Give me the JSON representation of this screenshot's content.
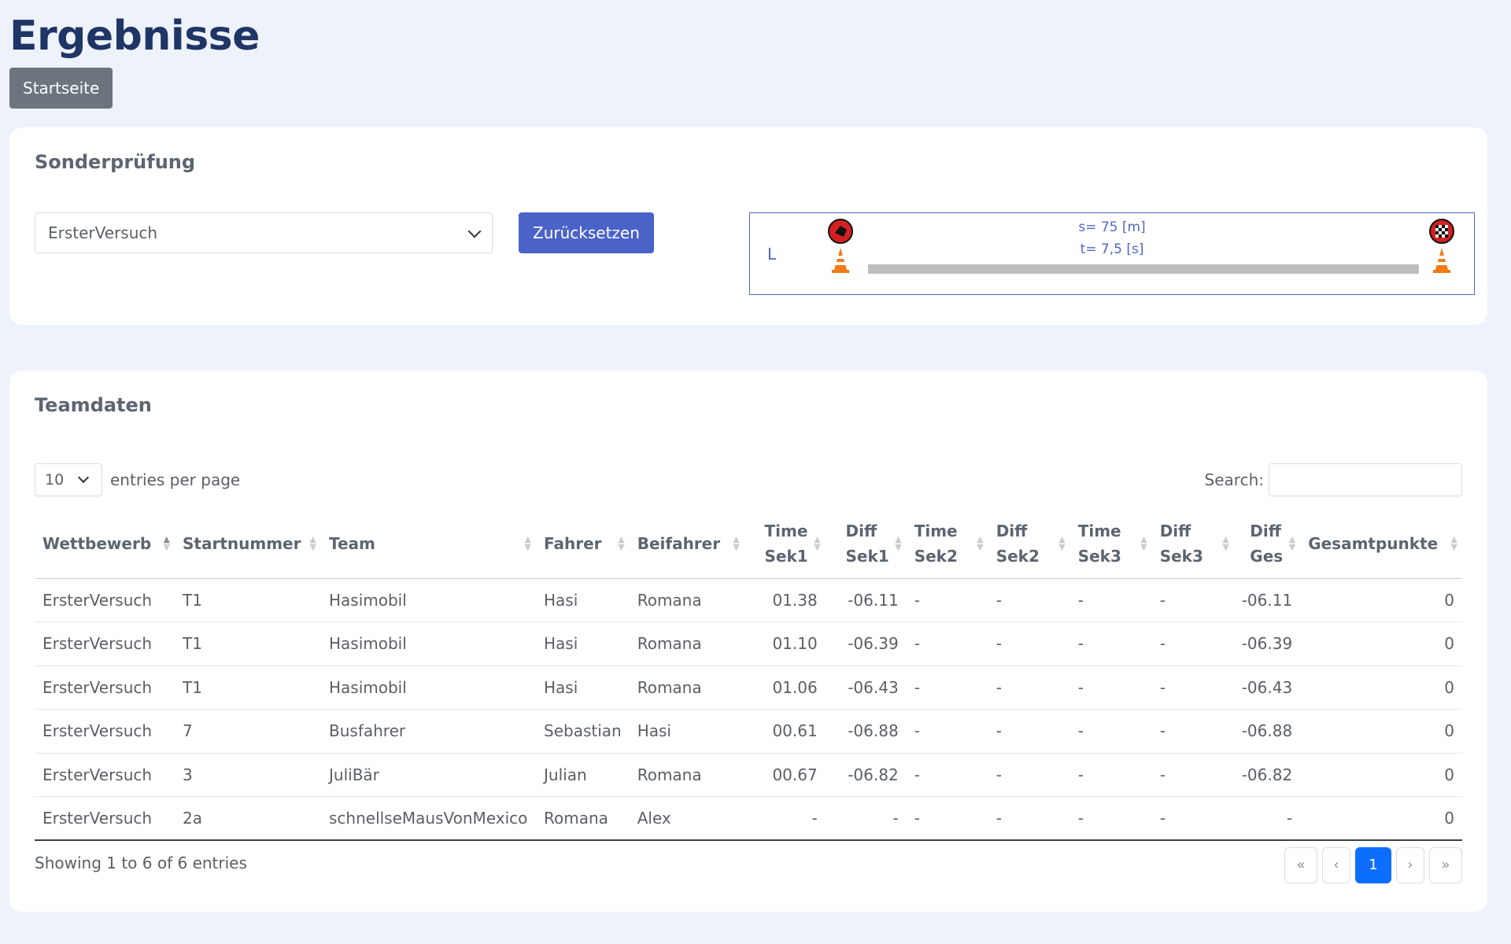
{
  "page": {
    "title": "Ergebnisse",
    "home_button": "Startseite"
  },
  "sonder": {
    "title": "Sonderprüfung",
    "selected": "ErsterVersuch",
    "reset_button": "Zurücksetzen",
    "course": {
      "side_label": "L",
      "distance": "s= 75 [m]",
      "time": "t= 7,5 [s]"
    }
  },
  "team": {
    "title": "Teamdaten",
    "entries_value": "10",
    "entries_label": "entries per page",
    "search_label": "Search:",
    "columns": {
      "wettbewerb": "Wettbewerb",
      "startnummer": "Startnummer",
      "team": "Team",
      "fahrer": "Fahrer",
      "beifahrer": "Beifahrer",
      "time_sek1_a": "Time",
      "time_sek1_b": "Sek1",
      "diff_sek1_a": "Diff",
      "diff_sek1_b": "Sek1",
      "time_sek2_a": "Time",
      "time_sek2_b": "Sek2",
      "diff_sek2_a": "Diff",
      "diff_sek2_b": "Sek2",
      "time_sek3_a": "Time",
      "time_sek3_b": "Sek3",
      "diff_sek3_a": "Diff",
      "diff_sek3_b": "Sek3",
      "diff_ges_a": "Diff",
      "diff_ges_b": "Ges",
      "gesamtpunkte": "Gesamtpunkte"
    },
    "rows": [
      [
        "ErsterVersuch",
        "T1",
        "Hasimobil",
        "Hasi",
        "Romana",
        "01.38",
        "-06.11",
        "-",
        "-",
        "-",
        "-",
        "-06.11",
        "0"
      ],
      [
        "ErsterVersuch",
        "T1",
        "Hasimobil",
        "Hasi",
        "Romana",
        "01.10",
        "-06.39",
        "-",
        "-",
        "-",
        "-",
        "-06.39",
        "0"
      ],
      [
        "ErsterVersuch",
        "T1",
        "Hasimobil",
        "Hasi",
        "Romana",
        "01.06",
        "-06.43",
        "-",
        "-",
        "-",
        "-",
        "-06.43",
        "0"
      ],
      [
        "ErsterVersuch",
        "7",
        "Busfahrer",
        "Sebastian",
        "Hasi",
        "00.61",
        "-06.88",
        "-",
        "-",
        "-",
        "-",
        "-06.88",
        "0"
      ],
      [
        "ErsterVersuch",
        "3",
        "JuliBär",
        "Julian",
        "Romana",
        "00.67",
        "-06.82",
        "-",
        "-",
        "-",
        "-",
        "-06.82",
        "0"
      ],
      [
        "ErsterVersuch",
        "2a",
        "schnellseMausVonMexico",
        "Romana",
        "Alex",
        "-",
        "-",
        "-",
        "-",
        "-",
        "-",
        "-",
        "0"
      ]
    ],
    "showing": "Showing 1 to 6 of 6 entries",
    "pager": {
      "first": "«",
      "prev": "‹",
      "current": "1",
      "next": "›",
      "last": "»"
    }
  }
}
